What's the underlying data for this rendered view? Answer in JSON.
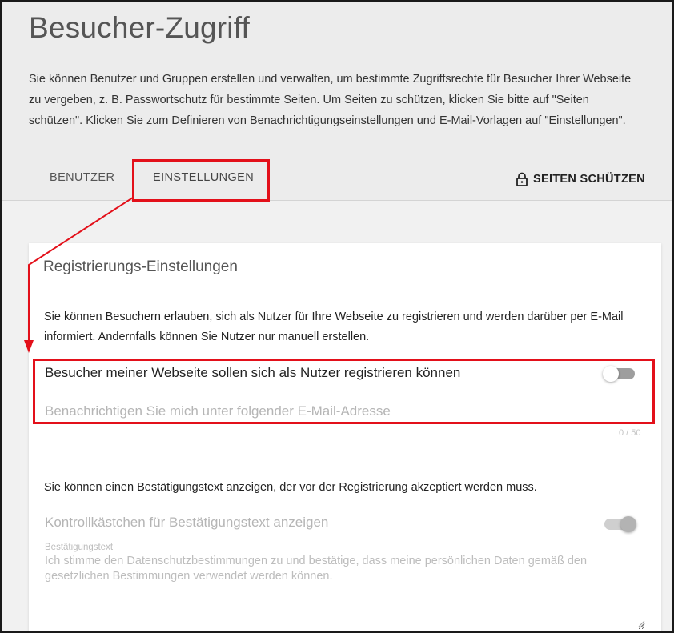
{
  "page": {
    "title": "Besucher-Zugriff",
    "intro": "Sie können Benutzer und Gruppen erstellen und verwalten, um bestimmte Zugriffsrechte für Besucher Ihrer Webseite zu vergeben, z. B. Passwortschutz für bestimmte Seiten. Um Seiten zu schützen, klicken Sie bitte auf \"Seiten schützen\". Klicken Sie zum Definieren von Benachrichtigungseinstellungen und E-Mail-Vorlagen auf \"Einstellungen\"."
  },
  "tabs": {
    "users": "Benutzer",
    "settings": "Einstellungen"
  },
  "actions": {
    "protect_pages": "Seiten schützen",
    "protect_icon": "lock-icon"
  },
  "registration": {
    "section_title": "Registrierungs-Einstellungen",
    "description": "Sie können Besuchern erlauben, sich als Nutzer für Ihre Webseite zu registrieren und werden darüber per E-Mail informiert. Andernfalls können Sie Nutzer nur manuell erstellen.",
    "toggle_label": "Besucher meiner Webseite sollen sich als Nutzer registrieren können",
    "toggle_on": false,
    "email_placeholder": "Benachrichtigen Sie mich unter folgender E-Mail-Adresse",
    "email_value": "",
    "char_counter": "0 / 50"
  },
  "confirmation": {
    "description": "Sie können einen Bestätigungstext anzeigen, der vor der Registrierung akzeptiert werden muss.",
    "checkbox_label": "Kontrollkästchen für Bestätigungstext anzeigen",
    "toggle_on": true,
    "text_label": "Bestätigungstext",
    "text_value": "Ich stimme den Datenschutzbestimmungen zu und bestätige, dass meine persönlichen Daten gemäß den gesetzlichen Bestimmungen verwendet werden können."
  },
  "colors": {
    "highlight": "#e3101a",
    "header_bg": "#ececec",
    "card_bg": "#ffffff"
  }
}
